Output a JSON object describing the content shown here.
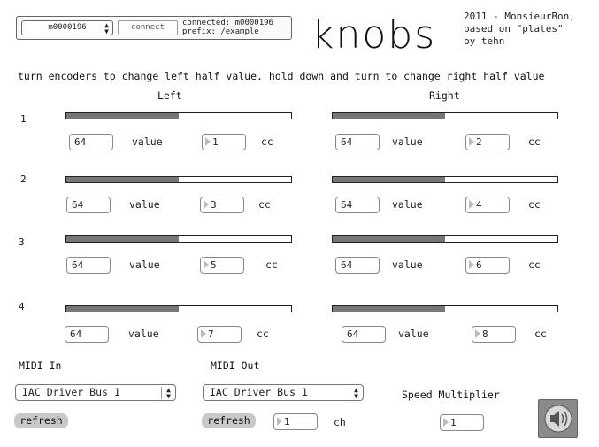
{
  "top": {
    "device_menu": "m0000196",
    "connect_label": "connect",
    "connected_text": "connected: m0000196",
    "prefix_text": "prefix: /example",
    "title": "knobs",
    "credits": "2011 - MonsieurBon,\nbased on \"plates\"\nby tehn"
  },
  "instructions": "turn encoders to change left half value. hold down and turn to change right half value",
  "columns": {
    "left": "Left",
    "right": "Right"
  },
  "rows": [
    {
      "label": "1",
      "left": {
        "level": 0.5,
        "value": "64",
        "value_label": "value",
        "cc": "1",
        "cc_label": "cc"
      },
      "right": {
        "level": 0.5,
        "value": "64",
        "value_label": "value",
        "cc": "2",
        "cc_label": "cc"
      }
    },
    {
      "label": "2",
      "left": {
        "level": 0.5,
        "value": "64",
        "value_label": "value",
        "cc": "3",
        "cc_label": "cc"
      },
      "right": {
        "level": 0.5,
        "value": "64",
        "value_label": "value",
        "cc": "4",
        "cc_label": "cc"
      }
    },
    {
      "label": "3",
      "left": {
        "level": 0.5,
        "value": "64",
        "value_label": "value",
        "cc": "5",
        "cc_label": "cc"
      },
      "right": {
        "level": 0.5,
        "value": "64",
        "value_label": "value",
        "cc": "6",
        "cc_label": "cc"
      }
    },
    {
      "label": "4",
      "left": {
        "level": 0.5,
        "value": "64",
        "value_label": "value",
        "cc": "7",
        "cc_label": "cc"
      },
      "right": {
        "level": 0.5,
        "value": "64",
        "value_label": "value",
        "cc": "8",
        "cc_label": "cc"
      }
    }
  ],
  "midi_in": {
    "label": "MIDI In",
    "selected": "IAC Driver Bus 1",
    "refresh": "refresh"
  },
  "midi_out": {
    "label": "MIDI Out",
    "selected": "IAC Driver Bus 1",
    "refresh": "refresh",
    "channel": "1",
    "channel_label": "ch"
  },
  "speed": {
    "label": "Speed Multiplier",
    "value": "1"
  },
  "colors": {
    "slider_fill": "#777777",
    "refresh_bg": "#c8c8c8",
    "speaker_bg": "#8a8a8a"
  },
  "icons": {
    "speaker": "speaker-icon"
  }
}
